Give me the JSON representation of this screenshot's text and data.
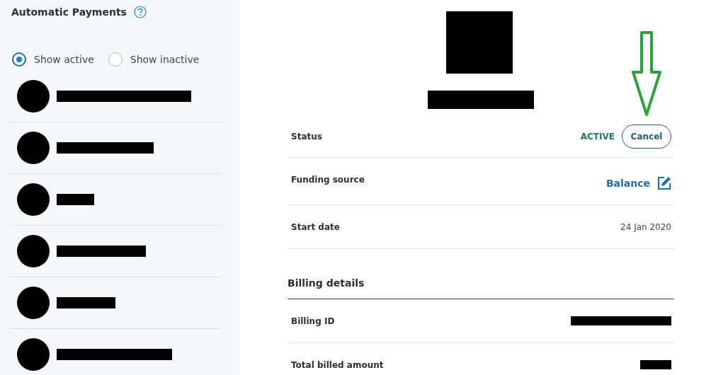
{
  "sidebar": {
    "title": "Automatic Payments",
    "filters": [
      {
        "label": "Show active",
        "selected": true
      },
      {
        "label": "Show inactive",
        "selected": false
      }
    ],
    "merchants": [
      {
        "kind": "redacted"
      },
      {
        "kind": "redacted"
      },
      {
        "kind": "redacted"
      },
      {
        "kind": "redacted"
      },
      {
        "kind": "redacted"
      },
      {
        "kind": "redacted"
      }
    ]
  },
  "details": {
    "fields": [
      {
        "kind": "status",
        "label": "Status",
        "value": "ACTIVE",
        "action": "Cancel"
      },
      {
        "kind": "editable",
        "label": "Funding source",
        "value": "Balance"
      },
      {
        "kind": "plain",
        "label": "Start date",
        "value": "24 Jan 2020"
      }
    ],
    "billing": {
      "title": "Billing details",
      "fields": [
        {
          "kind": "redacted",
          "label": "Billing ID"
        },
        {
          "kind": "redacted",
          "label": "Total billed amount"
        }
      ]
    }
  }
}
